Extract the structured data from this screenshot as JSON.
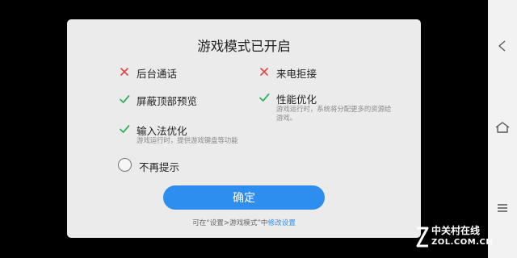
{
  "dialog": {
    "title": "游戏模式已开启",
    "options": [
      {
        "label": "后台通话",
        "state": "off",
        "desc": ""
      },
      {
        "label": "来电拒接",
        "state": "off",
        "desc": ""
      },
      {
        "label": "屏蔽顶部预览",
        "state": "on",
        "desc": ""
      },
      {
        "label": "性能优化",
        "state": "on",
        "desc": "游戏运行时，系统将分配更多的资源给游戏。"
      },
      {
        "label": "输入法优化",
        "state": "on",
        "desc": "游戏运行时，提供游戏键盘等功能"
      }
    ],
    "dont_remind_label": "不再提示",
    "confirm_label": "确定",
    "footnote_prefix": "可在“设置>游戏模式”中",
    "footnote_link": "修改设置"
  },
  "watermark": {
    "cn": "中关村在线",
    "en": "ZOL.COM.CN"
  },
  "colors": {
    "check": "#2eb35a",
    "cross": "#e04848",
    "accent": "#2d8ef0"
  },
  "icons": [
    "cross-icon",
    "check-icon",
    "nav-back-icon",
    "nav-home-icon",
    "nav-menu-icon"
  ]
}
